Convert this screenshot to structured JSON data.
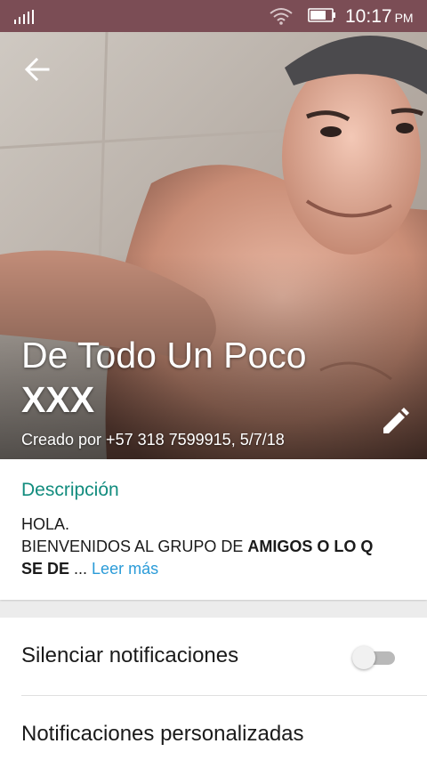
{
  "status_bar": {
    "time": "10:17",
    "ampm": "PM",
    "icons": [
      "signal-icon",
      "wifi-icon",
      "battery-icon"
    ]
  },
  "header": {
    "back_icon": "arrow-back-icon",
    "title_line1": "De Todo Un Poco",
    "title_line2": "XXX",
    "created_by": "Creado por +57 318 7599915, 5/7/18",
    "edit_icon": "pencil-icon"
  },
  "description": {
    "heading": "Descripción",
    "line1": "HOLA.",
    "line2_plain": "BIENVENIDOS AL GRUPO  DE ",
    "line2_bold": "AMIGOS O LO Q",
    "line3_bold": "SE DE",
    "ellipsis": " ... ",
    "read_more": "Leer más"
  },
  "settings": {
    "mute_label": "Silenciar notificaciones",
    "mute_enabled": false,
    "custom_label": "Notificaciones personalizadas"
  },
  "colors": {
    "status_bar": "#7b4d55",
    "accent": "#128c7e",
    "link": "#2a9bd8",
    "toggle_track_off": "#b9b9b9"
  }
}
